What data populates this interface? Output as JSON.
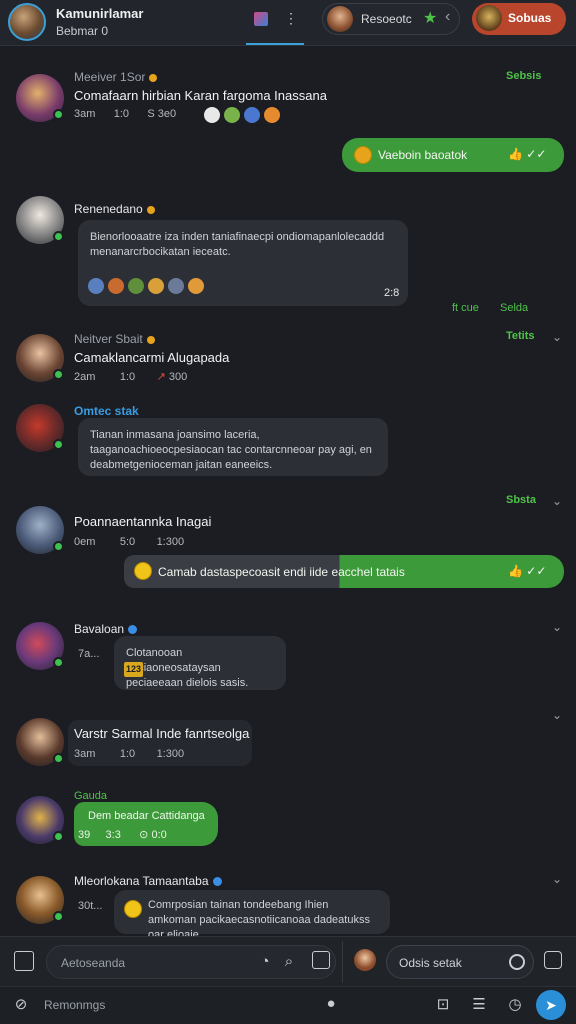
{
  "header": {
    "user_name": "Kamunirlamar",
    "user_status": "Bebmar 0",
    "contact_label": "Resoeotc",
    "status_label": "Sobuas"
  },
  "messages": [
    {
      "sender": "Meeiver 1Sor",
      "time": "Sebsis",
      "title": "Comafaarn hirbian Karan fargoma Inassana",
      "meta": [
        "3am",
        "1:0",
        "S 3e0"
      ]
    },
    {
      "outgoing": "Vaeboin baoatok"
    },
    {
      "sender": "Renenedano",
      "text": "Bienorlooaatre iza inden taniafinaecpi ondiomapanlolecaddd menanarcrbocikatan ieceatc.",
      "time": "2:8",
      "footer_left": "ft cue",
      "footer_right": "Selda"
    },
    {
      "sender": "Neitver Sbait",
      "time": "Tetits",
      "title": "Camaklancarmi Alugapada",
      "meta": [
        "2am",
        "1:0",
        "300"
      ]
    },
    {
      "sender": "Omtec stak",
      "text": "Tianan inmasana joansimo laceria, taaganoachioeocpesiaocan tac contarcnneoar pay agi, en deabmetgenioceman jaitan eaneeics."
    },
    {
      "sender": "",
      "time": "Sbsta",
      "title": "Poannaentannka Inagai",
      "meta": [
        "0em",
        "5:0",
        "1:300"
      ]
    },
    {
      "outgoing": "Camab dastaspecoasit endi iide eacchel tatais"
    },
    {
      "sender": "Bavaloan",
      "prefix": "7a...",
      "text": "Clotanooan deciaoneosataysan peciaeeaan dielois sasis.",
      "tag": "123"
    },
    {
      "sender": "",
      "title": "Varstr Sarmal Inde fanrtseolga",
      "meta": [
        "3am",
        "1:0",
        "1:300"
      ]
    },
    {
      "sender": "Gauda",
      "text": "Dem beadar Cattidanga",
      "meta": [
        "39",
        "3:3",
        "0:0"
      ]
    },
    {
      "sender": "Mleorlokana Tamaantaba",
      "prefix": "30t...",
      "text": "Comrposian tainan tondeebang Ihien amkoman pacikaecasnotiicanoaa dadeatukss oar elioaie."
    }
  ],
  "composer": {
    "left_placeholder": "Aetoseanda",
    "right_placeholder": "Odsis setak"
  },
  "bottom": {
    "label": "Remonmgs"
  },
  "colors": {
    "accent_green": "#3d9a3a",
    "accent_blue": "#2a8fd6",
    "status_pill": "#b9452c"
  }
}
